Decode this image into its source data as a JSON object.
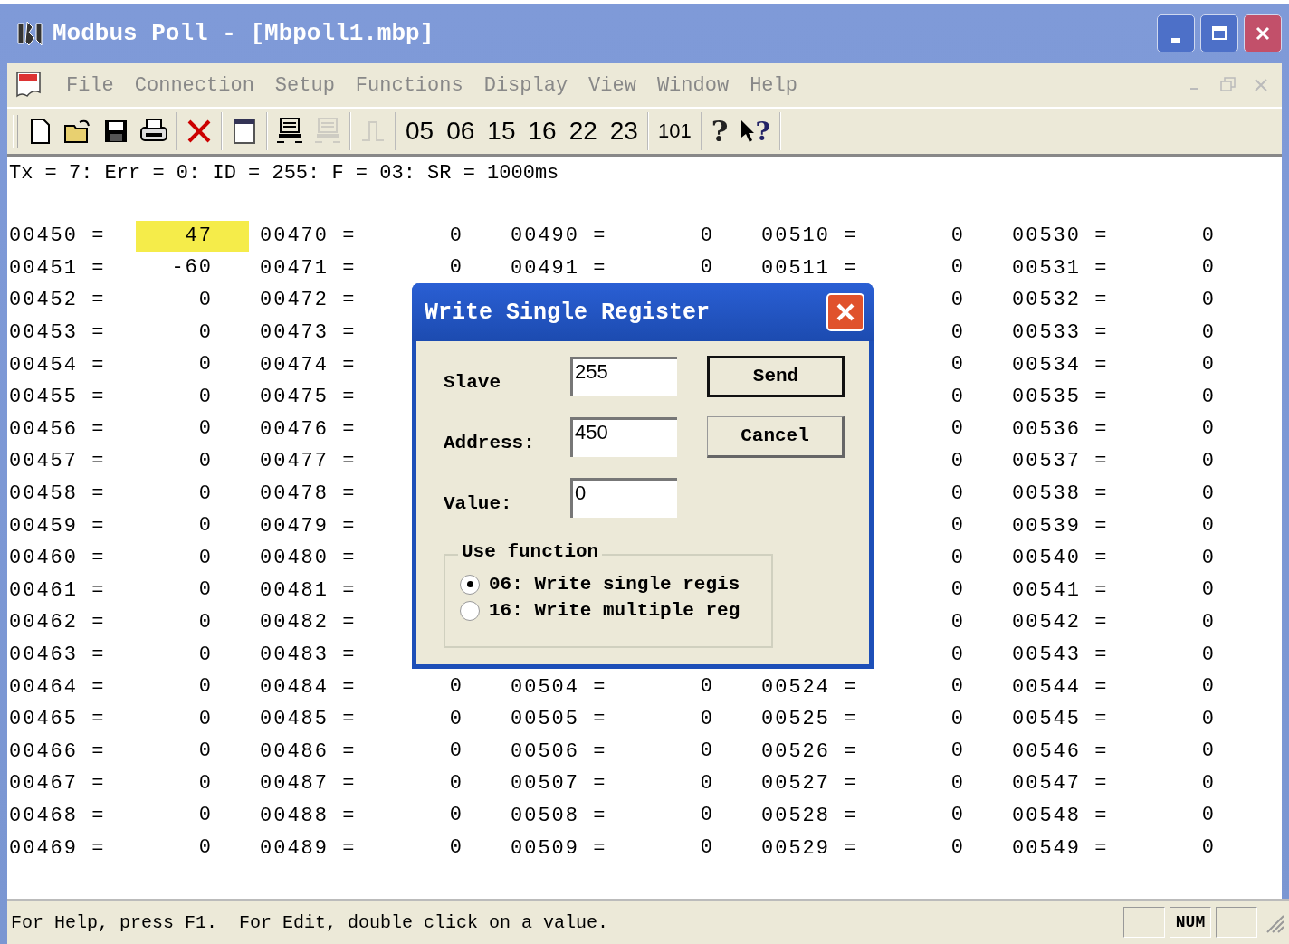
{
  "window": {
    "title": "Modbus Poll - [Mbpoll1.mbp]"
  },
  "menu": [
    {
      "label": "File"
    },
    {
      "label": "Connection"
    },
    {
      "label": "Setup"
    },
    {
      "label": "Functions"
    },
    {
      "label": "Display"
    },
    {
      "label": "View"
    },
    {
      "label": "Window"
    },
    {
      "label": "Help"
    }
  ],
  "toolbar": {
    "icons": [
      {
        "kind": "new",
        "disabled": false
      },
      {
        "kind": "open",
        "disabled": false
      },
      {
        "kind": "save",
        "disabled": false
      },
      {
        "kind": "print",
        "disabled": false
      },
      {
        "kind": "delete",
        "disabled": false
      },
      {
        "kind": "window",
        "disabled": false
      },
      {
        "kind": "connect",
        "disabled": false
      },
      {
        "kind": "disconnect",
        "disabled": true
      },
      {
        "kind": "pulse",
        "disabled": true
      }
    ],
    "function_codes": [
      "05",
      "06",
      "15",
      "16",
      "22",
      "23"
    ],
    "count_button": "101",
    "help": "?",
    "context_help": "?"
  },
  "status_line": "Tx = 7: Err = 0: ID = 255: F = 03: SR = 1000ms",
  "grid": [
    {
      "cells": [
        {
          "address": "00450 =",
          "value": "47",
          "highlighted": true
        },
        {
          "address": "00451 =",
          "value": "-60",
          "highlighted": false
        },
        {
          "address": "00452 =",
          "value": "0",
          "highlighted": false
        },
        {
          "address": "00453 =",
          "value": "0",
          "highlighted": false
        },
        {
          "address": "00454 =",
          "value": "0",
          "highlighted": false
        },
        {
          "address": "00455 =",
          "value": "0",
          "highlighted": false
        },
        {
          "address": "00456 =",
          "value": "0",
          "highlighted": false
        },
        {
          "address": "00457 =",
          "value": "0",
          "highlighted": false
        },
        {
          "address": "00458 =",
          "value": "0",
          "highlighted": false
        },
        {
          "address": "00459 =",
          "value": "0",
          "highlighted": false
        },
        {
          "address": "00460 =",
          "value": "0",
          "highlighted": false
        },
        {
          "address": "00461 =",
          "value": "0",
          "highlighted": false
        },
        {
          "address": "00462 =",
          "value": "0",
          "highlighted": false
        },
        {
          "address": "00463 =",
          "value": "0",
          "highlighted": false
        },
        {
          "address": "00464 =",
          "value": "0",
          "highlighted": false
        },
        {
          "address": "00465 =",
          "value": "0",
          "highlighted": false
        },
        {
          "address": "00466 =",
          "value": "0",
          "highlighted": false
        },
        {
          "address": "00467 =",
          "value": "0",
          "highlighted": false
        },
        {
          "address": "00468 =",
          "value": "0",
          "highlighted": false
        },
        {
          "address": "00469 =",
          "value": "0",
          "highlighted": false
        }
      ]
    },
    {
      "cells": [
        {
          "address": "00470 =",
          "value": "0",
          "highlighted": false
        },
        {
          "address": "00471 =",
          "value": "0",
          "highlighted": false
        },
        {
          "address": "00472 ="
        },
        {
          "address": "00473 ="
        },
        {
          "address": "00474 ="
        },
        {
          "address": "00475 ="
        },
        {
          "address": "00476 ="
        },
        {
          "address": "00477 ="
        },
        {
          "address": "00478 ="
        },
        {
          "address": "00479 ="
        },
        {
          "address": "00480 ="
        },
        {
          "address": "00481 ="
        },
        {
          "address": "00482 ="
        },
        {
          "address": "00483 ="
        },
        {
          "address": "00484 =",
          "value": "0",
          "highlighted": false
        },
        {
          "address": "00485 =",
          "value": "0",
          "highlighted": false
        },
        {
          "address": "00486 =",
          "value": "0",
          "highlighted": false
        },
        {
          "address": "00487 =",
          "value": "0",
          "highlighted": false
        },
        {
          "address": "00488 =",
          "value": "0",
          "highlighted": false
        },
        {
          "address": "00489 =",
          "value": "0",
          "highlighted": false
        }
      ]
    },
    {
      "cells": [
        {
          "address": "00490 =",
          "value": "0",
          "highlighted": false
        },
        {
          "address": "00491 =",
          "value": "0",
          "highlighted": false
        },
        {},
        {},
        {},
        {},
        {},
        {},
        {},
        {},
        {},
        {},
        {},
        {},
        {
          "address": "00504 =",
          "value": "0",
          "highlighted": false
        },
        {
          "address": "00505 =",
          "value": "0",
          "highlighted": false
        },
        {
          "address": "00506 =",
          "value": "0",
          "highlighted": false
        },
        {
          "address": "00507 =",
          "value": "0",
          "highlighted": false
        },
        {
          "address": "00508 =",
          "value": "0",
          "highlighted": false
        },
        {
          "address": "00509 =",
          "value": "0",
          "highlighted": false
        }
      ]
    },
    {
      "cells": [
        {
          "address": "00510 =",
          "value": "0",
          "highlighted": false
        },
        {
          "address": "00511 =",
          "value": "0",
          "highlighted": false
        },
        {
          "value": "0",
          "highlighted": false
        },
        {
          "value": "0",
          "highlighted": false
        },
        {
          "value": "0",
          "highlighted": false
        },
        {
          "value": "0",
          "highlighted": false
        },
        {
          "value": "0",
          "highlighted": false
        },
        {
          "value": "0",
          "highlighted": false
        },
        {
          "value": "0",
          "highlighted": false
        },
        {
          "value": "0",
          "highlighted": false
        },
        {
          "value": "0",
          "highlighted": false
        },
        {
          "value": "0",
          "highlighted": false
        },
        {
          "value": "0",
          "highlighted": false
        },
        {
          "value": "0",
          "highlighted": false
        },
        {
          "address": "00524 =",
          "value": "0",
          "highlighted": false
        },
        {
          "address": "00525 =",
          "value": "0",
          "highlighted": false
        },
        {
          "address": "00526 =",
          "value": "0",
          "highlighted": false
        },
        {
          "address": "00527 =",
          "value": "0",
          "highlighted": false
        },
        {
          "address": "00528 =",
          "value": "0",
          "highlighted": false
        },
        {
          "address": "00529 =",
          "value": "0",
          "highlighted": false
        }
      ]
    },
    {
      "cells": [
        {
          "address": "00530 =",
          "value": "0",
          "highlighted": false
        },
        {
          "address": "00531 =",
          "value": "0",
          "highlighted": false
        },
        {
          "address": "00532 =",
          "value": "0",
          "highlighted": false
        },
        {
          "address": "00533 =",
          "value": "0",
          "highlighted": false
        },
        {
          "address": "00534 =",
          "value": "0",
          "highlighted": false
        },
        {
          "address": "00535 =",
          "value": "0",
          "highlighted": false
        },
        {
          "address": "00536 =",
          "value": "0",
          "highlighted": false
        },
        {
          "address": "00537 =",
          "value": "0",
          "highlighted": false
        },
        {
          "address": "00538 =",
          "value": "0",
          "highlighted": false
        },
        {
          "address": "00539 =",
          "value": "0",
          "highlighted": false
        },
        {
          "address": "00540 =",
          "value": "0",
          "highlighted": false
        },
        {
          "address": "00541 =",
          "value": "0",
          "highlighted": false
        },
        {
          "address": "00542 =",
          "value": "0",
          "highlighted": false
        },
        {
          "address": "00543 =",
          "value": "0",
          "highlighted": false
        },
        {
          "address": "00544 =",
          "value": "0",
          "highlighted": false
        },
        {
          "address": "00545 =",
          "value": "0",
          "highlighted": false
        },
        {
          "address": "00546 =",
          "value": "0",
          "highlighted": false
        },
        {
          "address": "00547 =",
          "value": "0",
          "highlighted": false
        },
        {
          "address": "00548 =",
          "value": "0",
          "highlighted": false
        },
        {
          "address": "00549 =",
          "value": "0",
          "highlighted": false
        }
      ]
    }
  ],
  "dialog": {
    "title": "Write Single Register",
    "fields": [
      {
        "label": "Slave",
        "value": "255"
      },
      {
        "label": "Address:",
        "value": "450"
      },
      {
        "label": "Value:",
        "value": "0"
      }
    ],
    "buttons": [
      {
        "label": "Send",
        "default": true
      },
      {
        "label": "Cancel",
        "default": false
      }
    ],
    "group": {
      "title": "Use function",
      "options": [
        {
          "label": "06: Write single regis",
          "selected": true
        },
        {
          "label": "16: Write multiple reg",
          "selected": false
        }
      ]
    }
  },
  "status_bar": {
    "text": "For Help, press F1.  For Edit, double click on a value.",
    "indicator": "NUM"
  }
}
